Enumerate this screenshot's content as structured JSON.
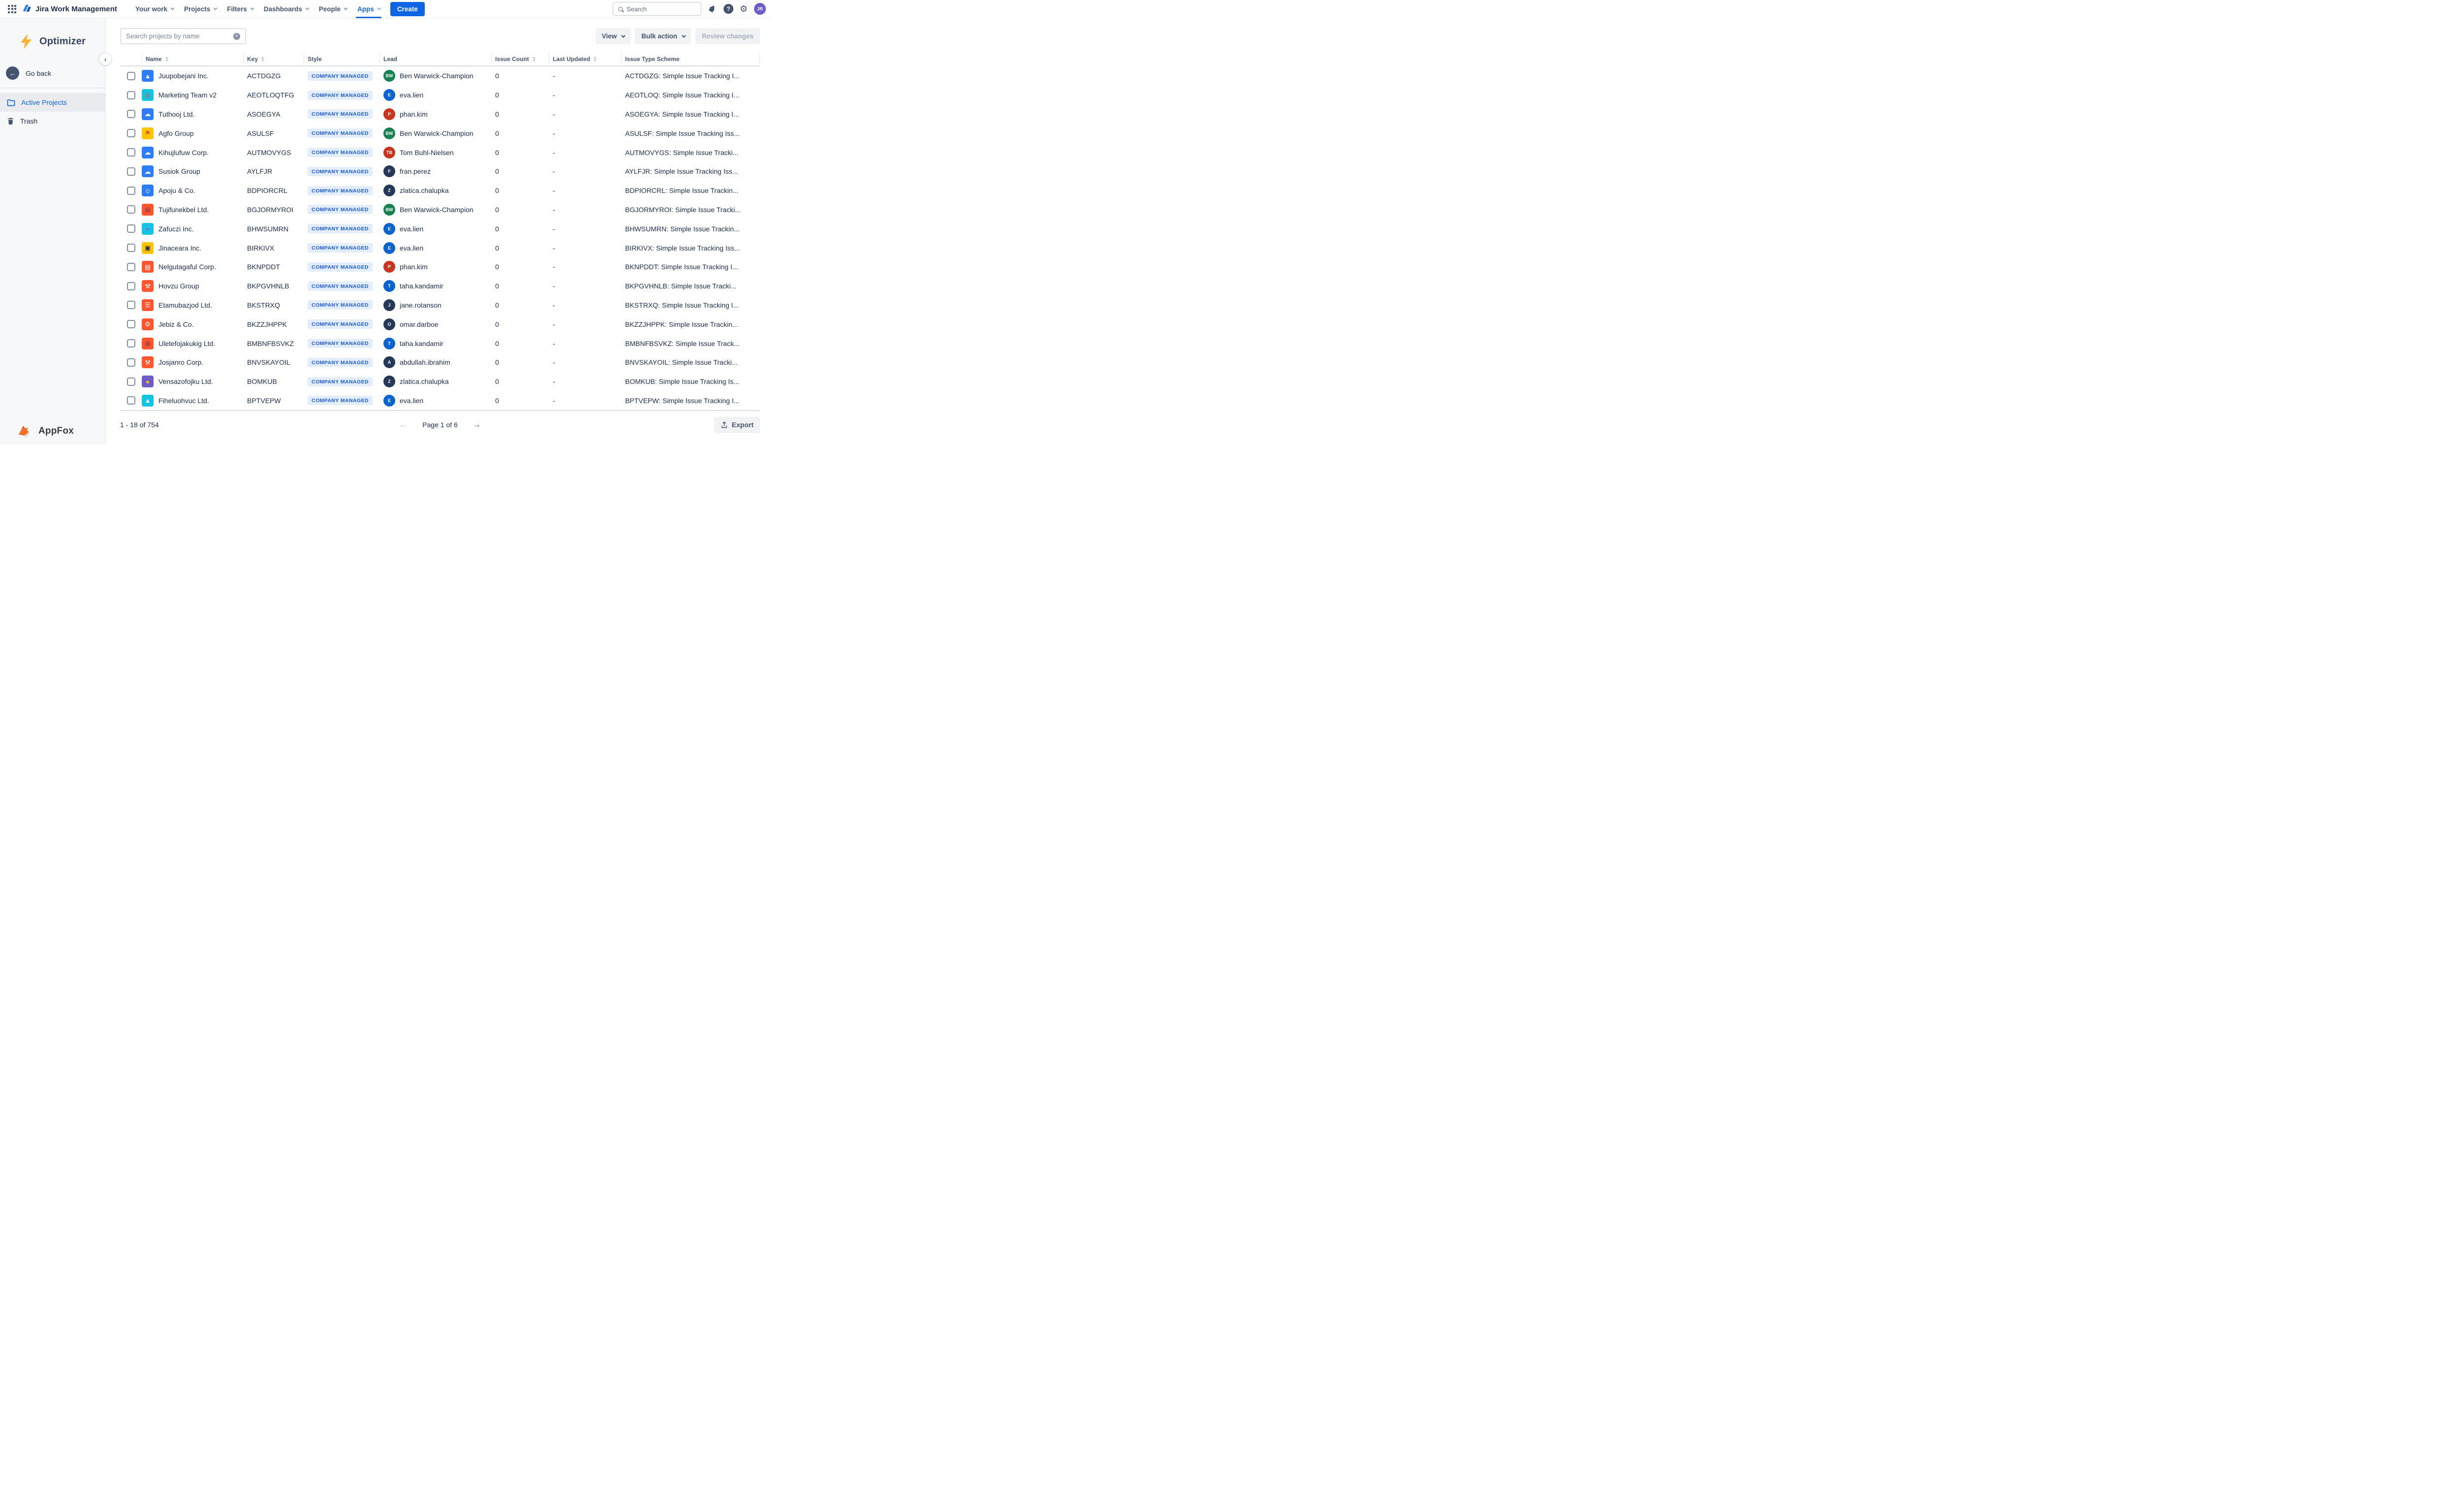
{
  "header": {
    "app_title": "Jira Work Management",
    "nav": [
      {
        "label": "Your work",
        "active": false
      },
      {
        "label": "Projects",
        "active": false
      },
      {
        "label": "Filters",
        "active": false
      },
      {
        "label": "Dashboards",
        "active": false
      },
      {
        "label": "People",
        "active": false
      },
      {
        "label": "Apps",
        "active": true
      }
    ],
    "create_label": "Create",
    "search_placeholder": "Search",
    "avatar_initials": "JR",
    "icons": [
      "app-switcher-icon",
      "notifications-bell-icon",
      "help-icon",
      "settings-gear-icon"
    ]
  },
  "sidebar": {
    "app_name": "Optimizer",
    "go_back_label": "Go back",
    "items": [
      {
        "label": "Active Projects",
        "icon": "folder-icon",
        "active": true
      },
      {
        "label": "Trash",
        "icon": "trash-icon",
        "active": false
      }
    ],
    "footer_brand": "AppFox"
  },
  "toolbar": {
    "search_placeholder": "Search projects by name",
    "view_label": "View",
    "bulk_action_label": "Bulk action",
    "review_changes_label": "Review changes",
    "review_changes_disabled": true
  },
  "table": {
    "columns": [
      {
        "label": "Name",
        "sortable": true
      },
      {
        "label": "Key",
        "sortable": true
      },
      {
        "label": "Style",
        "sortable": false
      },
      {
        "label": "Lead",
        "sortable": false
      },
      {
        "label": "Issue Count",
        "sortable": true
      },
      {
        "label": "Last Updated",
        "sortable": true
      },
      {
        "label": "Issue Type Scheme",
        "sortable": false
      }
    ],
    "style_badge": "COMPANY MANAGED",
    "badge_bg": "#E2EDFD",
    "badge_fg": "#1D5BD8",
    "rows": [
      {
        "name": "Juupobejani Inc.",
        "key": "ACTDGZG",
        "icon_name": "mountain",
        "icon_bg": "#2E7CF6",
        "icon_fg": "#FFFFFF",
        "icon_glyph": "▲",
        "lead": "Ben Warwick-Champion",
        "lead_initials": "BW",
        "lead_color": "#17824F",
        "issue_count": "0",
        "last_updated": "-",
        "scheme": "ACTDGZG: Simple Issue Tracking I..."
      },
      {
        "name": "Marketing Team v2",
        "key": "AEOTLOQTFG",
        "icon_name": "lifebuoy",
        "icon_bg": "#12C4E0",
        "icon_fg": "#E8483F",
        "icon_glyph": "◎",
        "lead": "eva.lien",
        "lead_initials": "E",
        "lead_color": "#0B63CE",
        "issue_count": "0",
        "last_updated": "-",
        "scheme": "AEOTLOQ: Simple Issue Tracking I..."
      },
      {
        "name": "Tuthooj Ltd.",
        "key": "ASOEGYA",
        "icon_name": "cloud",
        "icon_bg": "#2E7CF6",
        "icon_fg": "#FFFFFF",
        "icon_glyph": "☁",
        "lead": "phan.kim",
        "lead_initials": "P",
        "lead_color": "#CA3521",
        "issue_count": "0",
        "last_updated": "-",
        "scheme": "ASOEGYA: Simple Issue Tracking I..."
      },
      {
        "name": "Agfo Group",
        "key": "ASULSF",
        "icon_name": "flag",
        "icon_bg": "#FFC400",
        "icon_fg": "#E8483F",
        "icon_glyph": "⚑",
        "lead": "Ben Warwick-Champion",
        "lead_initials": "BW",
        "lead_color": "#17824F",
        "issue_count": "0",
        "last_updated": "-",
        "scheme": "ASULSF: Simple Issue Tracking Iss..."
      },
      {
        "name": "Kihujlufuw Corp.",
        "key": "AUTMOVYGS",
        "icon_name": "cloud",
        "icon_bg": "#2E7CF6",
        "icon_fg": "#FFFFFF",
        "icon_glyph": "☁",
        "lead": "Tom Buhl-Nielsen",
        "lead_initials": "TB",
        "lead_color": "#CA3521",
        "issue_count": "0",
        "last_updated": "-",
        "scheme": "AUTMOVYGS: Simple Issue Tracki..."
      },
      {
        "name": "Susiok Group",
        "key": "AYLFJR",
        "icon_name": "cloud",
        "icon_bg": "#2E7CF6",
        "icon_fg": "#FFFFFF",
        "icon_glyph": "☁",
        "lead": "fran.perez",
        "lead_initials": "F",
        "lead_color": "#253858",
        "issue_count": "0",
        "last_updated": "-",
        "scheme": "AYLFJR: Simple Issue Tracking Iss..."
      },
      {
        "name": "Apoju & Co.",
        "key": "BDPIORCRL",
        "icon_name": "phone-call",
        "icon_bg": "#2E7CF6",
        "icon_fg": "#FFFFFF",
        "icon_glyph": "☺",
        "lead": "zlatica.chalupka",
        "lead_initials": "Z",
        "lead_color": "#253858",
        "issue_count": "0",
        "last_updated": "-",
        "scheme": "BDPIORCRL: Simple Issue Trackin..."
      },
      {
        "name": "Tujifunekbel Ltd.",
        "key": "BGJORMYROI",
        "icon_name": "vinyl-record",
        "icon_bg": "#FF5630",
        "icon_fg": "#1D2B4C",
        "icon_glyph": "◎",
        "lead": "Ben Warwick-Champion",
        "lead_initials": "BW",
        "lead_color": "#17824F",
        "issue_count": "0",
        "last_updated": "-",
        "scheme": "BGJORMYROI: Simple Issue Tracki..."
      },
      {
        "name": "Zafuczi Inc.",
        "key": "BHWSUMRN",
        "icon_name": "monster",
        "icon_bg": "#12C4E0",
        "icon_fg": "#7E6DD8",
        "icon_glyph": "●",
        "lead": "eva.lien",
        "lead_initials": "E",
        "lead_color": "#0B63CE",
        "issue_count": "0",
        "last_updated": "-",
        "scheme": "BHWSUMRN: Simple Issue Trackin..."
      },
      {
        "name": "Jinaceara Inc.",
        "key": "BIRKIVX",
        "icon_name": "wallet",
        "icon_bg": "#FFC400",
        "icon_fg": "#1D2B4C",
        "icon_glyph": "▣",
        "lead": "eva.lien",
        "lead_initials": "E",
        "lead_color": "#0B63CE",
        "issue_count": "0",
        "last_updated": "-",
        "scheme": "BIRKIVX: Simple Issue Tracking Iss..."
      },
      {
        "name": "Nelgutagaful Corp.",
        "key": "BKNPDDT",
        "icon_name": "browser-rocket",
        "icon_bg": "#FF5630",
        "icon_fg": "#FFFFFF",
        "icon_glyph": "▤",
        "lead": "phan.kim",
        "lead_initials": "P",
        "lead_color": "#CA3521",
        "issue_count": "0",
        "last_updated": "-",
        "scheme": "BKNPDDT: Simple Issue Tracking I..."
      },
      {
        "name": "Hovzu Group",
        "key": "BKPGVHNLB",
        "icon_name": "wrench",
        "icon_bg": "#FF5630",
        "icon_fg": "#FFFFFF",
        "icon_glyph": "⚒",
        "lead": "taha.kandamir",
        "lead_initials": "T",
        "lead_color": "#0B63CE",
        "issue_count": "0",
        "last_updated": "-",
        "scheme": "BKPGVHNLB: Simple Issue Tracki..."
      },
      {
        "name": "Etamubazjod Ltd.",
        "key": "BKSTRXQ",
        "icon_name": "checklist",
        "icon_bg": "#FF5630",
        "icon_fg": "#FFFFFF",
        "icon_glyph": "☰",
        "lead": "jane.rotanson",
        "lead_initials": "J",
        "lead_color": "#253858",
        "issue_count": "0",
        "last_updated": "-",
        "scheme": "BKSTRXQ: Simple Issue Tracking I..."
      },
      {
        "name": "Jebiz & Co.",
        "key": "BKZZJHPPK",
        "icon_name": "sliders",
        "icon_bg": "#FF5630",
        "icon_fg": "#FFFFFF",
        "icon_glyph": "⚙",
        "lead": "omar.darboe",
        "lead_initials": "O",
        "lead_color": "#253858",
        "issue_count": "0",
        "last_updated": "-",
        "scheme": "BKZZJHPPK: Simple Issue Trackin..."
      },
      {
        "name": "Uletefojakukig Ltd.",
        "key": "BMBNFBSVKZ",
        "icon_name": "vinyl-record",
        "icon_bg": "#FF5630",
        "icon_fg": "#1D2B4C",
        "icon_glyph": "◎",
        "lead": "taha.kandamir",
        "lead_initials": "T",
        "lead_color": "#0B63CE",
        "issue_count": "0",
        "last_updated": "-",
        "scheme": "BMBNFBSVKZ: Simple Issue Track..."
      },
      {
        "name": "Josjanro Corp.",
        "key": "BNVSKAYOIL",
        "icon_name": "wrench",
        "icon_bg": "#FF5630",
        "icon_fg": "#FFFFFF",
        "icon_glyph": "⚒",
        "lead": "abdullah.ibrahim",
        "lead_initials": "A",
        "lead_color": "#253858",
        "issue_count": "0",
        "last_updated": "-",
        "scheme": "BNVSKAYOIL: Simple Issue Tracki..."
      },
      {
        "name": "Vensazofojku Ltd.",
        "key": "BOMKUB",
        "icon_name": "parrot",
        "icon_bg": "#6E5DC6",
        "icon_fg": "#FFC400",
        "icon_glyph": "●",
        "lead": "zlatica.chalupka",
        "lead_initials": "Z",
        "lead_color": "#253858",
        "issue_count": "0",
        "last_updated": "-",
        "scheme": "BOMKUB: Simple Issue Tracking Is..."
      },
      {
        "name": "Fiheluohvuc Ltd.",
        "key": "BPTVEPW",
        "icon_name": "rocket",
        "icon_bg": "#12C4E0",
        "icon_fg": "#FFFFFF",
        "icon_glyph": "▲",
        "lead": "eva.lien",
        "lead_initials": "E",
        "lead_color": "#0B63CE",
        "issue_count": "0",
        "last_updated": "-",
        "scheme": "BPTVEPW: Simple Issue Tracking I..."
      }
    ]
  },
  "footer": {
    "range_text": "1 - 18 of 754",
    "page_text": "Page 1 of 6",
    "prev_arrow": "←",
    "next_arrow": "→",
    "export_label": "Export"
  },
  "colors": {
    "brand_blue": "#1868DB",
    "button_blue": "#0C66E4",
    "sidebar_bg": "#F7F8F9",
    "active_item_bg": "#E9EBEE",
    "navy_text": "#1D2B4C"
  }
}
